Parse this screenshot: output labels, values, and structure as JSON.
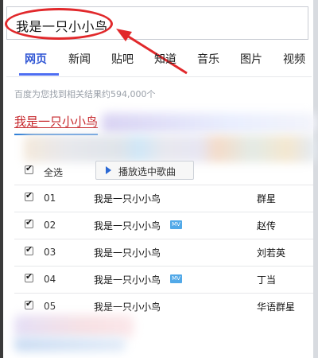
{
  "search": {
    "query": "我是一只小小鸟"
  },
  "tabs": [
    {
      "label": "网页",
      "active": true
    },
    {
      "label": "新闻",
      "active": false
    },
    {
      "label": "贴吧",
      "active": false
    },
    {
      "label": "知道",
      "active": false
    },
    {
      "label": "音乐",
      "active": false
    },
    {
      "label": "图片",
      "active": false
    },
    {
      "label": "视频",
      "active": false
    }
  ],
  "result_count": "百度为您找到相关结果约594,000个",
  "result_title": "我是一只小小鸟",
  "playlist": {
    "select_all": "全选",
    "play_selected": "播放选中歌曲",
    "songs": [
      {
        "num": "01",
        "title": "我是一只小小鸟",
        "artist": "群星",
        "mv": false,
        "checked": true
      },
      {
        "num": "02",
        "title": "我是一只小小鸟",
        "artist": "赵传",
        "mv": true,
        "checked": true
      },
      {
        "num": "03",
        "title": "我是一只小小鸟",
        "artist": "刘若英",
        "mv": false,
        "checked": true
      },
      {
        "num": "04",
        "title": "我是一只小小鸟",
        "artist": "丁当",
        "mv": true,
        "checked": true
      },
      {
        "num": "05",
        "title": "我是一只小小鸟",
        "artist": "华语群星",
        "mv": false,
        "checked": true
      }
    ]
  },
  "colors": {
    "active_tab": "#2f55d4",
    "result_title": "#c6262b",
    "annotation": "#e1282b",
    "mv_badge": "#52a9e8"
  },
  "icons": {
    "play": "play-icon",
    "checkbox": "checkbox-checked-icon",
    "mv": "mv-badge-icon"
  }
}
